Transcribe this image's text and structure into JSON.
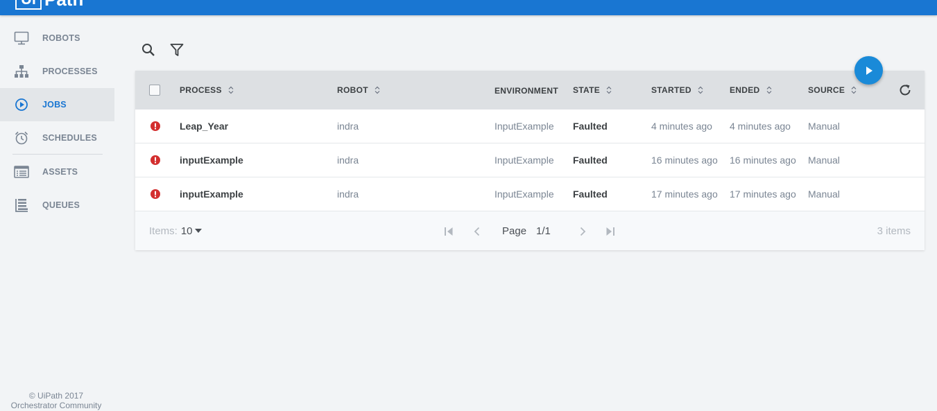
{
  "app": {
    "logo_box": "Ui",
    "logo_text": "Path"
  },
  "sidebar": {
    "items": [
      {
        "label": "ROBOTS",
        "icon": "monitor-icon",
        "active": false
      },
      {
        "label": "PROCESSES",
        "icon": "hierarchy-icon",
        "active": false
      },
      {
        "label": "JOBS",
        "icon": "play-circle-icon",
        "active": true
      },
      {
        "label": "SCHEDULES",
        "icon": "alarm-clock-icon",
        "active": false
      },
      {
        "label": "ASSETS",
        "icon": "list-card-icon",
        "active": false
      },
      {
        "label": "QUEUES",
        "icon": "queue-stack-icon",
        "active": false
      }
    ],
    "footer": {
      "line1": "© UiPath 2017",
      "line2": "Orchestrator Community"
    }
  },
  "toolbar": {
    "search_icon": "search-icon",
    "filter_icon": "filter-icon"
  },
  "table": {
    "columns": [
      "PROCESS",
      "ROBOT",
      "ENVIRONMENT",
      "STATE",
      "STARTED",
      "ENDED",
      "SOURCE"
    ],
    "rows": [
      {
        "process": "Leap_Year",
        "robot": "indra",
        "environment": "InputExample",
        "state": "Faulted",
        "started": "4 minutes ago",
        "ended": "4 minutes ago",
        "source": "Manual"
      },
      {
        "process": "inputExample",
        "robot": "indra",
        "environment": "InputExample",
        "state": "Faulted",
        "started": "16 minutes ago",
        "ended": "16 minutes ago",
        "source": "Manual"
      },
      {
        "process": "inputExample",
        "robot": "indra",
        "environment": "InputExample",
        "state": "Faulted",
        "started": "17 minutes ago",
        "ended": "17 minutes ago",
        "source": "Manual"
      }
    ]
  },
  "pagination": {
    "items_label": "Items:",
    "items_per_page": "10",
    "page_label": "Page",
    "page_value": "1/1",
    "total": "3 items"
  },
  "colors": {
    "brand": "#1976d2",
    "fab": "#1a8ad8",
    "error": "#d32f2f"
  }
}
